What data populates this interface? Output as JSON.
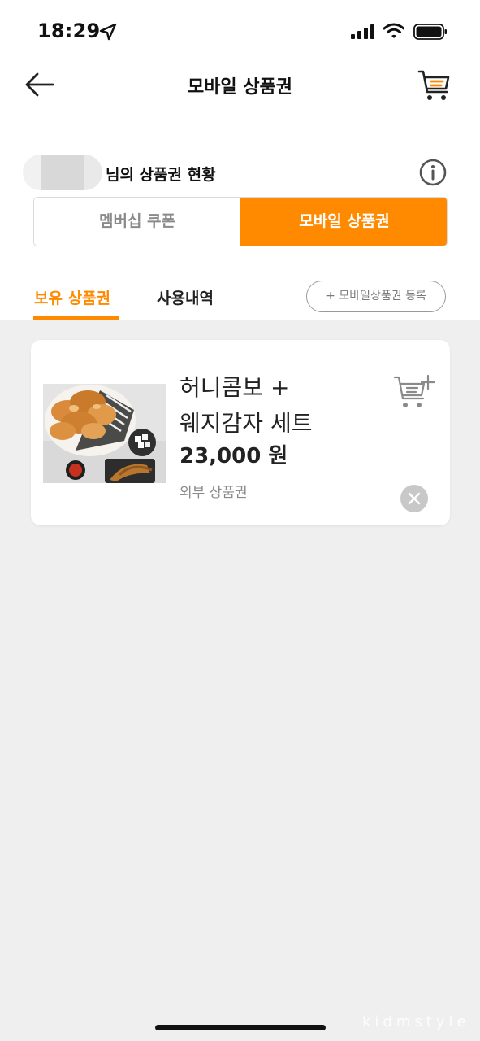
{
  "status_bar": {
    "time": "18:29"
  },
  "header": {
    "title": "모바일 상품권"
  },
  "owner": {
    "title": "님의 상품권 현황"
  },
  "segment": {
    "left_label": "멤버십 쿠폰",
    "right_label": "모바일 상품권",
    "active": "right"
  },
  "tabs": {
    "owned": "보유 상품권",
    "history": "사용내역",
    "register_button": "+ 모바일상품권 등록"
  },
  "vouchers": [
    {
      "name_line1": "허니콤보 +",
      "name_line2": "웨지감자 세트",
      "price": "23,000 원",
      "type": "외부 상품권"
    }
  ],
  "watermark": "kidmstyle",
  "colors": {
    "accent": "#ff8a00",
    "background": "#efefef",
    "muted_text": "#8a8a8a"
  },
  "icons": [
    "location-arrow-icon",
    "signal-icon",
    "wifi-icon",
    "battery-icon",
    "back-arrow-icon",
    "cart-icon",
    "info-icon",
    "add-to-cart-icon",
    "remove-icon"
  ]
}
